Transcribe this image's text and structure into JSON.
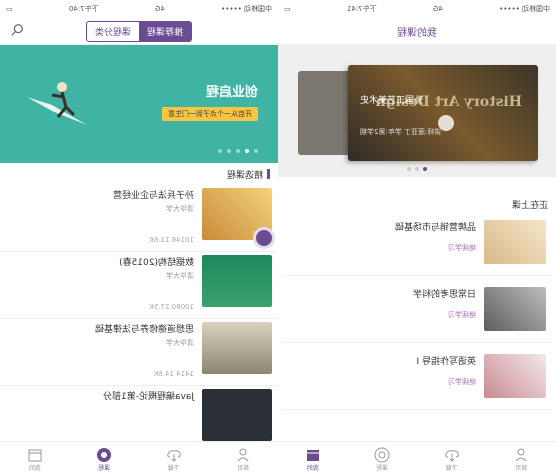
{
  "left": {
    "status": {
      "carrier": "中国移动 •••••",
      "net": "4G",
      "time": "下午7:40",
      "battery": ""
    },
    "tabs_toggle": {
      "active": "推荐课程",
      "inactive": "课程分类"
    },
    "banner": {
      "title": "创业启程",
      "subtitle": "开启从一个点子到一门生意"
    },
    "section_title": "精选课程",
    "courses": [
      {
        "name": "孙子兵法与企业经营",
        "org": "清华大学",
        "learners": "10146",
        "count": "11.6K"
      },
      {
        "name": "数据结构(2015春)",
        "org": "清华大学",
        "learners": "10080",
        "count": "27.5K"
      },
      {
        "name": "思想道德修养与法律基础",
        "org": "清华大学",
        "learners": "1414",
        "count": "14.6K"
      },
      {
        "name": "Java编程概论-第1部分",
        "org": "",
        "learners": "",
        "count": ""
      }
    ],
    "tabbar": [
      {
        "label": "首页",
        "icon": "home-icon"
      },
      {
        "label": "下载",
        "icon": "download-icon"
      },
      {
        "label": "课程",
        "icon": "courses-icon"
      },
      {
        "label": "我的",
        "icon": "profile-icon"
      }
    ],
    "accent": "#6a4c93",
    "banner_color": "#3fb3a4"
  },
  "right": {
    "status": {
      "carrier": "中国移动 •••••",
      "net": "4G",
      "time": "下午7:41",
      "battery": ""
    },
    "title": "我的课程",
    "book": {
      "title_cn": "外国工艺美术史",
      "title_en": "History Art Design",
      "meta": "讲师:唐亚丁 学年:第2学期"
    },
    "learning_title": "正在上课",
    "learning": [
      {
        "name": "品牌营销与市场基础",
        "continue": "继续学习"
      },
      {
        "name": "日常思考的科学",
        "continue": "继续学习"
      },
      {
        "name": "英语写作指导 I",
        "continue": "继续学习"
      }
    ],
    "tabbar": [
      {
        "label": "首页",
        "icon": "home-icon"
      },
      {
        "label": "下载",
        "icon": "download-icon"
      },
      {
        "label": "课程",
        "icon": "courses-icon"
      },
      {
        "label": "我的",
        "icon": "profile-icon"
      }
    ]
  }
}
